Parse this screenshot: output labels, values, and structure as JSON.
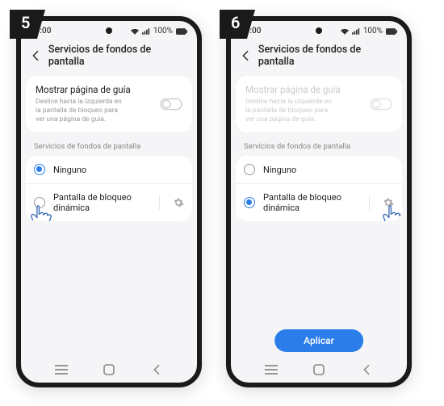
{
  "steps": [
    {
      "number": "5"
    },
    {
      "number": "6"
    }
  ],
  "statusbar": {
    "time": "10:00",
    "battery_pct": "100%"
  },
  "header": {
    "title": "Servicios de fondos de pantalla"
  },
  "guide_card": {
    "title": "Mostrar página de guía",
    "desc": "Deslice hacia la izquierda en la pantalla de bloqueo para ver una página de guía."
  },
  "section_label": "Servicios de fondos de pantalla",
  "options": {
    "none": "Ninguno",
    "dynamic": "Pantalla de bloqueo dinámica"
  },
  "apply_button": "Aplicar",
  "step5": {
    "selected": "none"
  },
  "step6": {
    "selected": "dynamic"
  }
}
